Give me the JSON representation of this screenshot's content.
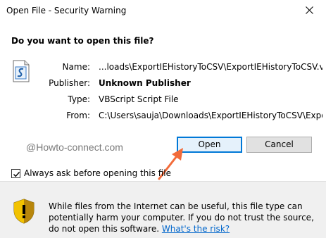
{
  "window": {
    "title": "Open File - Security Warning"
  },
  "dialog": {
    "question": "Do you want to open this file?",
    "fields": {
      "name_label": "Name:",
      "name_value": "...loads\\ExportIEHistoryToCSV\\ExportIEHistoryToCSV.vbs",
      "publisher_label": "Publisher:",
      "publisher_value": "Unknown Publisher",
      "type_label": "Type:",
      "type_value": "VBScript Script File",
      "from_label": "From:",
      "from_value": "C:\\Users\\sauja\\Downloads\\ExportIEHistoryToCSV\\Expo..."
    },
    "watermark": "@Howto-connect.com",
    "buttons": {
      "open_label": "Open",
      "cancel_label": "Cancel"
    },
    "checkbox": {
      "label": "Always ask before opening this file",
      "checked": true
    }
  },
  "footer": {
    "warning_text": "While files from the Internet can be useful, this file type can potentially harm your computer. If you do not trust the source, do not open this software.",
    "risk_link": "What's the risk?"
  },
  "icons": {
    "close": "close-icon",
    "file": "vbscript-file-icon",
    "shield": "security-shield-icon",
    "arrow": "annotation-arrow"
  },
  "colors": {
    "accent": "#0078d7",
    "link": "#0066cc",
    "arrow": "#f26b3a",
    "footer_bg": "#f0f0f0"
  }
}
